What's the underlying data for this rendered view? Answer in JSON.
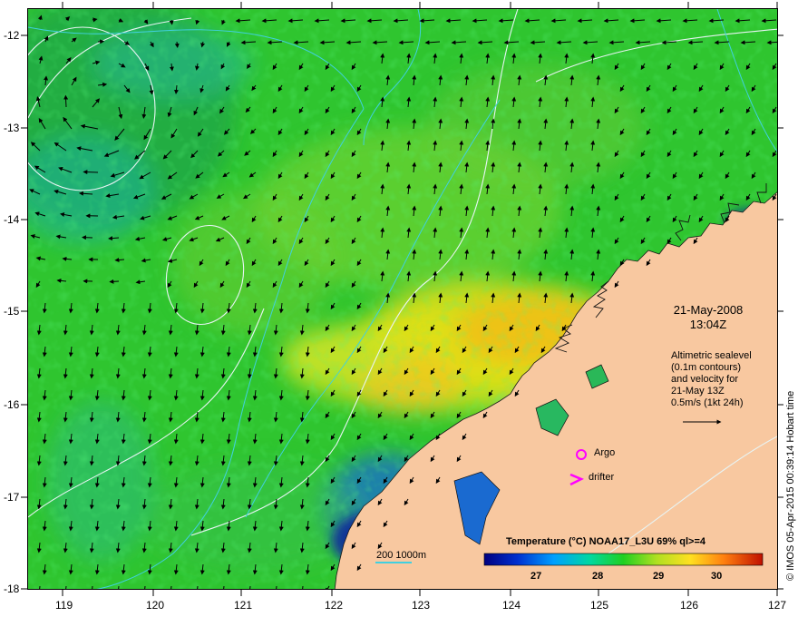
{
  "map": {
    "lat_ticks": [
      "-12",
      "-13",
      "-14",
      "-15",
      "-16",
      "-17",
      "-18"
    ],
    "lon_ticks": [
      "119",
      "120",
      "121",
      "122",
      "123",
      "124",
      "125",
      "126",
      "127"
    ]
  },
  "annotations": {
    "date": "21-May-2008",
    "time": "13:04Z",
    "info_lines": [
      "Altimetric sealevel",
      "(0.1m contours)",
      "and velocity for",
      "21-May 13Z",
      "0.5m/s (1kt 24h)"
    ],
    "argo_label": "Argo",
    "drifter_label": "drifter",
    "depth_label": "200  1000m",
    "credit": "© IMOS 05-Apr-2015 00:39:14 Hobart time"
  },
  "colorbar": {
    "title": "Temperature (°C) NOAA17_L3U 69% ql>=4",
    "ticks": [
      "27",
      "28",
      "29",
      "30"
    ]
  },
  "colors": {
    "ocean_base": "#2fc52f",
    "land": "#f8c8a0",
    "contour": "#e8f4f4",
    "isobath": "#40d0e0",
    "marker": "#ff00ff"
  }
}
